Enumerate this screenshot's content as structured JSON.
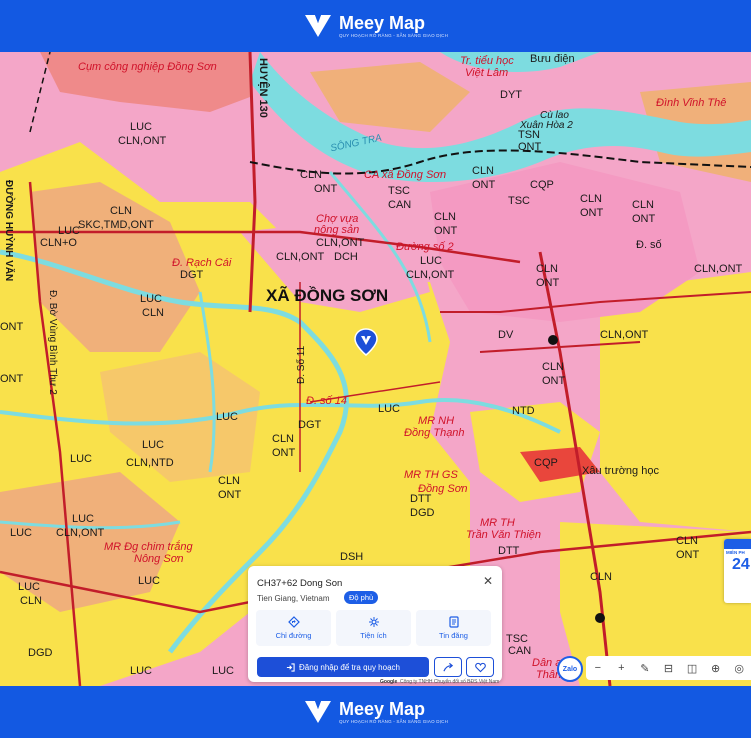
{
  "brand": {
    "name": "Meey Map",
    "tagline": "QUY HOẠCH RÕ RÀNG - SẴN SÀNG GIAO DỊCH"
  },
  "map": {
    "region_label": "XÃ ĐỒNG SƠN",
    "labels": {
      "industrial": "Cụm công nghiệp Đồng Sơn",
      "huyen_130": "HUYỆN 130",
      "song_tra": "SÔNG TRA",
      "tt_tieu_hoc": "Tr. tiểu học",
      "viet_lam": "Việt Lâm",
      "buu_dien": "Bưu điện",
      "dinh_vinh_the": "Đình Vĩnh Thê",
      "cu_lao": "Cù lao",
      "xuan_hoa": "Xuân Hòa 2",
      "ca_xa": "CA xã Đồng Sơn",
      "cho_vua": "Chợ vựa",
      "nong_san": "nông sản",
      "duong_so_2": "Đường số 2",
      "d_so": "Đ. số",
      "d_rach_cai": "Đ. Rạch Cái",
      "d_so_11": "Đ. Số 11",
      "d_so_14": "Đ. số 14",
      "mr_nh": "MR NH",
      "dong_thanh": "Đồng Thạnh",
      "mr_th_gs": "MR TH GS",
      "dong_son_red": "Đồng Sơn",
      "truong_hoc": "Xâu trường học",
      "mr_th": "MR TH",
      "tran_van_thien": "Trần Văn Thiện",
      "mr_chim": "MR Đg chim trắng",
      "nong_son": "Nông Sơn",
      "duong_huynh": "ĐƯỜNG HUỲNH VĂN",
      "d_bo_vung": "Đ. Bờ Vùng Bình Thư 2",
      "dan_an": "Dân an",
      "than": "Thân",
      "lucs": [
        "LUC",
        "LUC",
        "LUC",
        "LUC",
        "LUC",
        "LUC",
        "LUC",
        "LUC",
        "LUC",
        "LUC",
        "LUC",
        "LUC",
        "LUC",
        "LUC"
      ],
      "cln": "CLN",
      "ont": "ONT",
      "cln_ont": "CLN,ONT",
      "dgt": "DGT",
      "dch": "DCH",
      "tsc": "TSC",
      "dtt": "DTT",
      "dsh": "DSH",
      "dgd": "DGD",
      "can": "CAN",
      "dyt": "DYT",
      "tsn": "TSN",
      "cqp": "CQP",
      "ntd": "NTD",
      "dv": "DV",
      "sk": "SKC,TMD,ONT",
      "cln_ntd": "CLN,NTD",
      "cln_o": "CLN+O"
    }
  },
  "place_card": {
    "title": "CH37+62 Dong Son",
    "subtitle": "Tien Giang, Vietnam",
    "badge": "Độ phủ",
    "actions": [
      {
        "label": "Chỉ đường",
        "icon": "directions-icon"
      },
      {
        "label": "Tiện ích",
        "icon": "utilities-icon"
      },
      {
        "label": "Tin đăng",
        "icon": "listing-icon"
      }
    ],
    "login_label": "Đăng nhập để tra quy hoạch",
    "share_icon": "share-icon",
    "favorite_icon": "heart-icon"
  },
  "zalo_label": "Zalo",
  "toolbar": {
    "zoom_out": "−",
    "zoom_in": "+",
    "ruler": "✎",
    "layers": "⊟",
    "split": "◫",
    "globe": "⊕",
    "compass": "◎"
  },
  "credit": {
    "prefix": "Google",
    "text": "Công ty TNHH Chuyển đổi số BĐS Việt Nam"
  },
  "side_widget": {
    "label": "MIỄN PH",
    "number": "24"
  },
  "colors": {
    "brand": "#1359e2",
    "agri": "#f9e14b",
    "residential": "#f4a6c8",
    "industrial": "#ef8a8a",
    "canal": "#7ddce0"
  }
}
